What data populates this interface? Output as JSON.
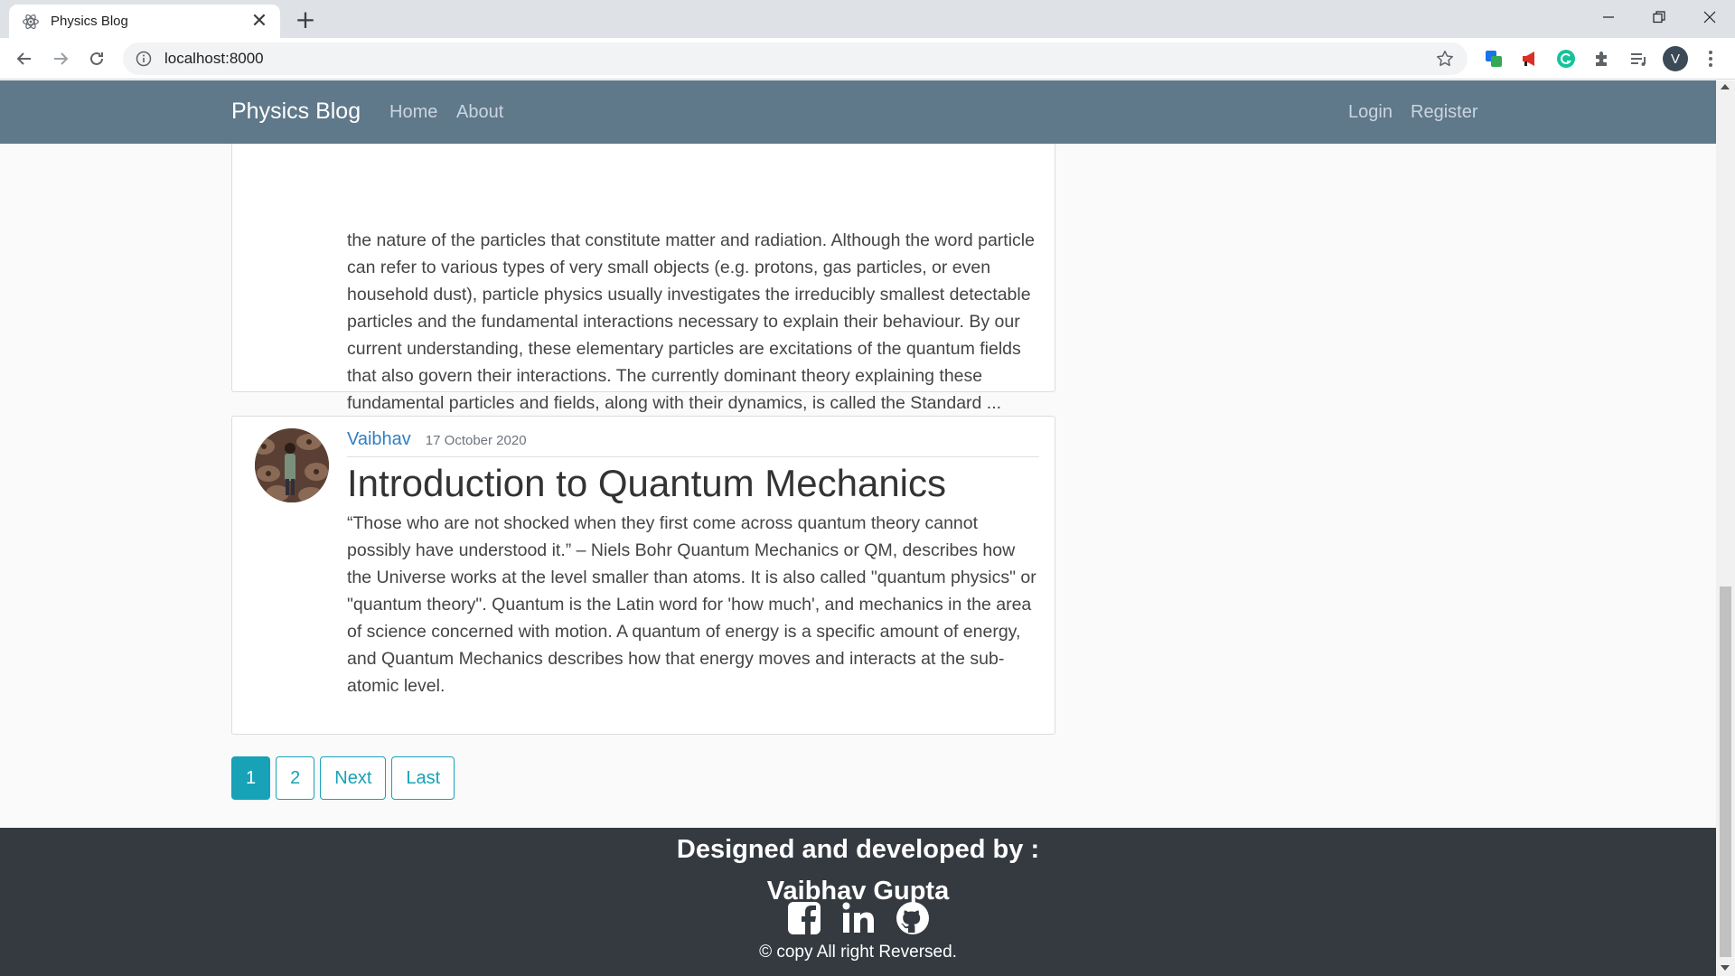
{
  "browser": {
    "tab_title": "Physics Blog",
    "url": "localhost:8000",
    "profile_initial": "V",
    "new_tab_label": "+"
  },
  "navbar": {
    "brand": "Physics Blog",
    "left_links": [
      "Home",
      "About"
    ],
    "right_links": [
      "Login",
      "Register"
    ]
  },
  "posts": [
    {
      "excerpt": "the nature of the particles that constitute matter and radiation. Although the word particle can refer to various types of very small objects (e.g. protons, gas particles, or even household dust), particle physics usually investigates the irreducibly smallest detectable particles and the fundamental interactions necessary to explain their behaviour. By our current understanding, these elementary particles are excitations of the quantum fields that also govern their interactions. The currently dominant theory explaining these fundamental particles and fields, along with their dynamics, is called the Standard ..."
    },
    {
      "author": "Vaibhav",
      "date": "17 October 2020",
      "title": "Introduction to Quantum Mechanics",
      "excerpt": "“Those who are not shocked when they first come across quantum theory cannot possibly have understood it.” – Niels Bohr Quantum Mechanics or QM, describes how the Universe works at the level smaller than atoms. It is also called \"quantum physics\" or \"quantum theory\". Quantum is the Latin word for 'how much', and mechanics in the area of science concerned with motion. A quantum of energy is a specific amount of energy, and Quantum Mechanics describes how that energy moves and interacts at the sub-atomic level."
    }
  ],
  "pagination": {
    "pages": [
      "1",
      "2"
    ],
    "next": "Next",
    "last": "Last",
    "current": "1"
  },
  "footer": {
    "heading": "Designed and developed by :",
    "name": "Vaibhav Gupta",
    "copyright": "© copy All right Reversed.",
    "icons": [
      "facebook-icon",
      "linkedin-icon",
      "github-icon"
    ]
  },
  "colors": {
    "navbar_bg": "#5f788a",
    "accent": "#17a2b8",
    "link": "#2f7fc1",
    "footer_bg": "#343a40"
  }
}
